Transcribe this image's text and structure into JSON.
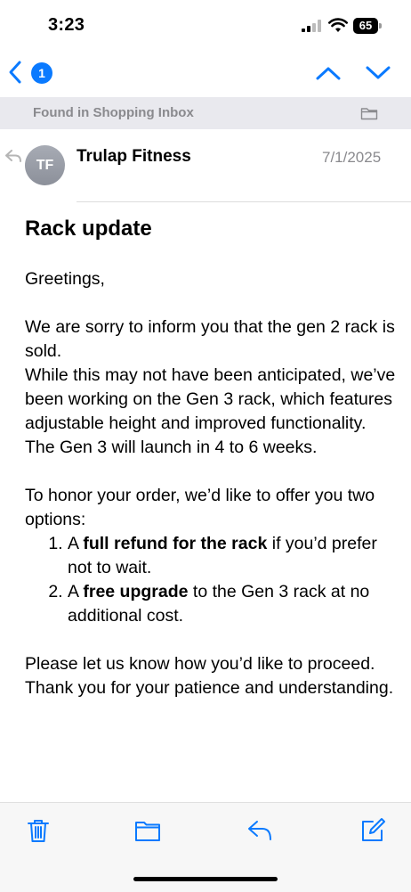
{
  "status_bar": {
    "time": "3:23",
    "battery": "65"
  },
  "nav": {
    "badge_count": "1"
  },
  "banner": {
    "text": "Found in Shopping Inbox"
  },
  "message": {
    "avatar_initials": "TF",
    "sender": "Trulap Fitness",
    "date": "7/1/2025",
    "subject": "Rack update",
    "greeting": "Greetings,",
    "para1_line1": "We are sorry to inform you that the gen 2 rack is sold.",
    "para1_line2": "While this may not have been anticipated, we’ve been working on the Gen 3 rack, which features adjustable height and improved functionality. The Gen 3 will launch in 4 to 6 weeks.",
    "para2": "To honor your order, we’d like to offer you two options:",
    "options": [
      {
        "prefix": "A ",
        "bold": "full refund for the rack",
        "suffix": " if you’d prefer not to wait."
      },
      {
        "prefix": "A ",
        "bold": "free upgrade",
        "suffix": " to the Gen 3 rack at no additional cost."
      }
    ],
    "closing_line1": "Please let us know how you’d like to proceed.",
    "closing_line2": "Thank you for your patience and understanding."
  },
  "colors": {
    "accent": "#0a7aff",
    "banner_bg": "#e9e9ee",
    "muted_text": "#8a8a8e"
  },
  "icons": [
    "signal-icon",
    "wifi-icon",
    "battery-icon",
    "back-chevron-icon",
    "up-chevron-icon",
    "down-chevron-icon",
    "folder-icon",
    "reply-icon",
    "trash-icon",
    "compose-icon"
  ]
}
